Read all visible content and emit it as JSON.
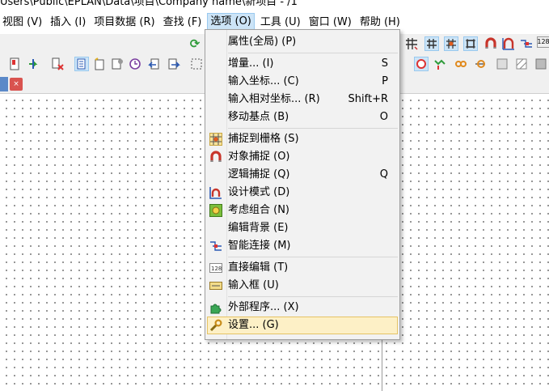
{
  "window": {
    "title": "Users\\Public\\EPLAN\\Data\\项目\\Company name\\新项目 - /1"
  },
  "menubar": {
    "items": [
      {
        "label": "视图 (V)"
      },
      {
        "label": "插入 (I)"
      },
      {
        "label": "项目数据 (R)"
      },
      {
        "label": "查找 (F)"
      },
      {
        "label": "选项 (O)"
      },
      {
        "label": "工具 (U)"
      },
      {
        "label": "窗口 (W)"
      },
      {
        "label": "帮助 (H)"
      }
    ]
  },
  "tabstrip": {
    "close_glyph": "×"
  },
  "options_menu": {
    "items": [
      {
        "label": "属性(全局) (P)",
        "shortcut": "",
        "icon": "none"
      },
      {
        "label": "增量... (I)",
        "shortcut": "S",
        "icon": "none"
      },
      {
        "label": "输入坐标... (C)",
        "shortcut": "P",
        "icon": "none"
      },
      {
        "label": "输入相对坐标... (R)",
        "shortcut": "Shift+R",
        "icon": "none"
      },
      {
        "label": "移动基点 (B)",
        "shortcut": "O",
        "icon": "none"
      },
      {
        "label": "捕捉到栅格 (S)",
        "shortcut": "",
        "icon": "grid-snap-icon"
      },
      {
        "label": "对象捕捉 (O)",
        "shortcut": "",
        "icon": "magnet-icon"
      },
      {
        "label": "逻辑捕捉 (Q)",
        "shortcut": "Q",
        "icon": "none"
      },
      {
        "label": "设计模式 (D)",
        "shortcut": "",
        "icon": "design-mode-icon"
      },
      {
        "label": "考虑组合 (N)",
        "shortcut": "",
        "icon": "group-icon"
      },
      {
        "label": "编辑背景 (E)",
        "shortcut": "",
        "icon": "none"
      },
      {
        "label": "智能连接 (M)",
        "shortcut": "",
        "icon": "smart-connect-icon"
      },
      {
        "label": "直接编辑 (T)",
        "shortcut": "",
        "icon": "direct-edit-icon"
      },
      {
        "label": "输入框 (U)",
        "shortcut": "",
        "icon": "input-box-icon"
      },
      {
        "label": "外部程序... (X)",
        "shortcut": "",
        "icon": "puzzle-icon"
      },
      {
        "label": "设置... (G)",
        "shortcut": "",
        "icon": "wrench-icon"
      }
    ]
  }
}
